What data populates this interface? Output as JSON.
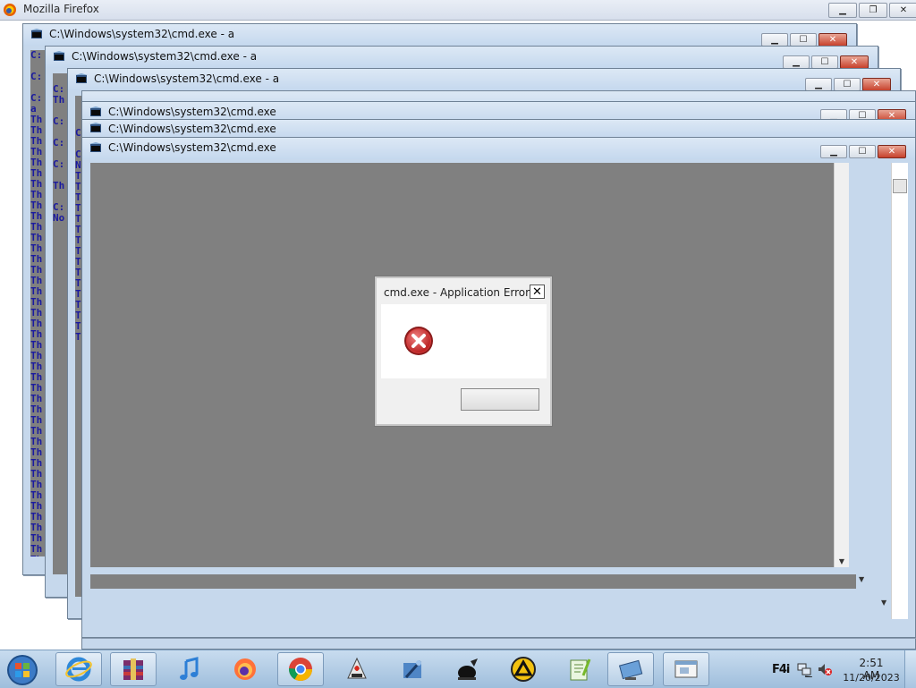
{
  "firefox": {
    "title": "Mozilla Firefox"
  },
  "windows": [
    {
      "title": "C:\\Windows\\system32\\cmd.exe - a",
      "lines": [
        "C:",
        "",
        "C:",
        "",
        "C:",
        "a",
        "Th",
        "Th",
        "Th",
        "Th",
        "Th",
        "Th",
        "Th",
        "Th",
        "Th",
        "Th",
        "Th",
        "Th",
        "Th",
        "Th",
        "Th",
        "Th",
        "Th",
        "Th",
        "Th",
        "Th",
        "Th",
        "Th",
        "Th",
        "Th",
        "Th",
        "Th",
        "Th",
        "Th",
        "Th",
        "Th",
        "Th",
        "Th",
        "Th",
        "Th",
        "Th",
        "Th",
        "Th",
        "Th",
        "Th",
        "Th",
        "Th",
        "Th",
        "Th",
        "Th"
      ]
    },
    {
      "title": "C:\\Windows\\system32\\cmd.exe - a",
      "lines": [
        "",
        "C:",
        "Th",
        "",
        "C:",
        "",
        "C:",
        "",
        "C:",
        "",
        "Th",
        "",
        "C:",
        "No"
      ]
    },
    {
      "title": "C:\\Windows\\system32\\cmd.exe - a",
      "lines": [
        "",
        "",
        "",
        "C",
        "",
        "C",
        "N",
        "T",
        "T",
        "T",
        "T",
        "T",
        "T",
        "T",
        "T",
        "T",
        "T",
        "T",
        "T",
        "T",
        "T",
        "T",
        "T"
      ]
    },
    {
      "title": "C:\\Windows\\system32\\cmd.exe",
      "lines": []
    },
    {
      "title": "C:\\Windows\\system32\\cmd.exe",
      "lines": []
    },
    {
      "title": "C:\\Windows\\system32\\cmd.exe",
      "lines": []
    }
  ],
  "dialog": {
    "title": "cmd.exe - Application Error",
    "close": "✕",
    "button_label": ""
  },
  "taskbar": {
    "items": [
      "Internet Explorer",
      "WinRAR",
      "iTunes",
      "Firefox",
      "Chrome",
      "Java",
      "Tool",
      "Ink",
      "AIMP",
      "Notepad++",
      "Remote",
      "Viewer"
    ],
    "tray_label": "F4i",
    "time": "2:51 AM",
    "date": "11/20/2023"
  }
}
